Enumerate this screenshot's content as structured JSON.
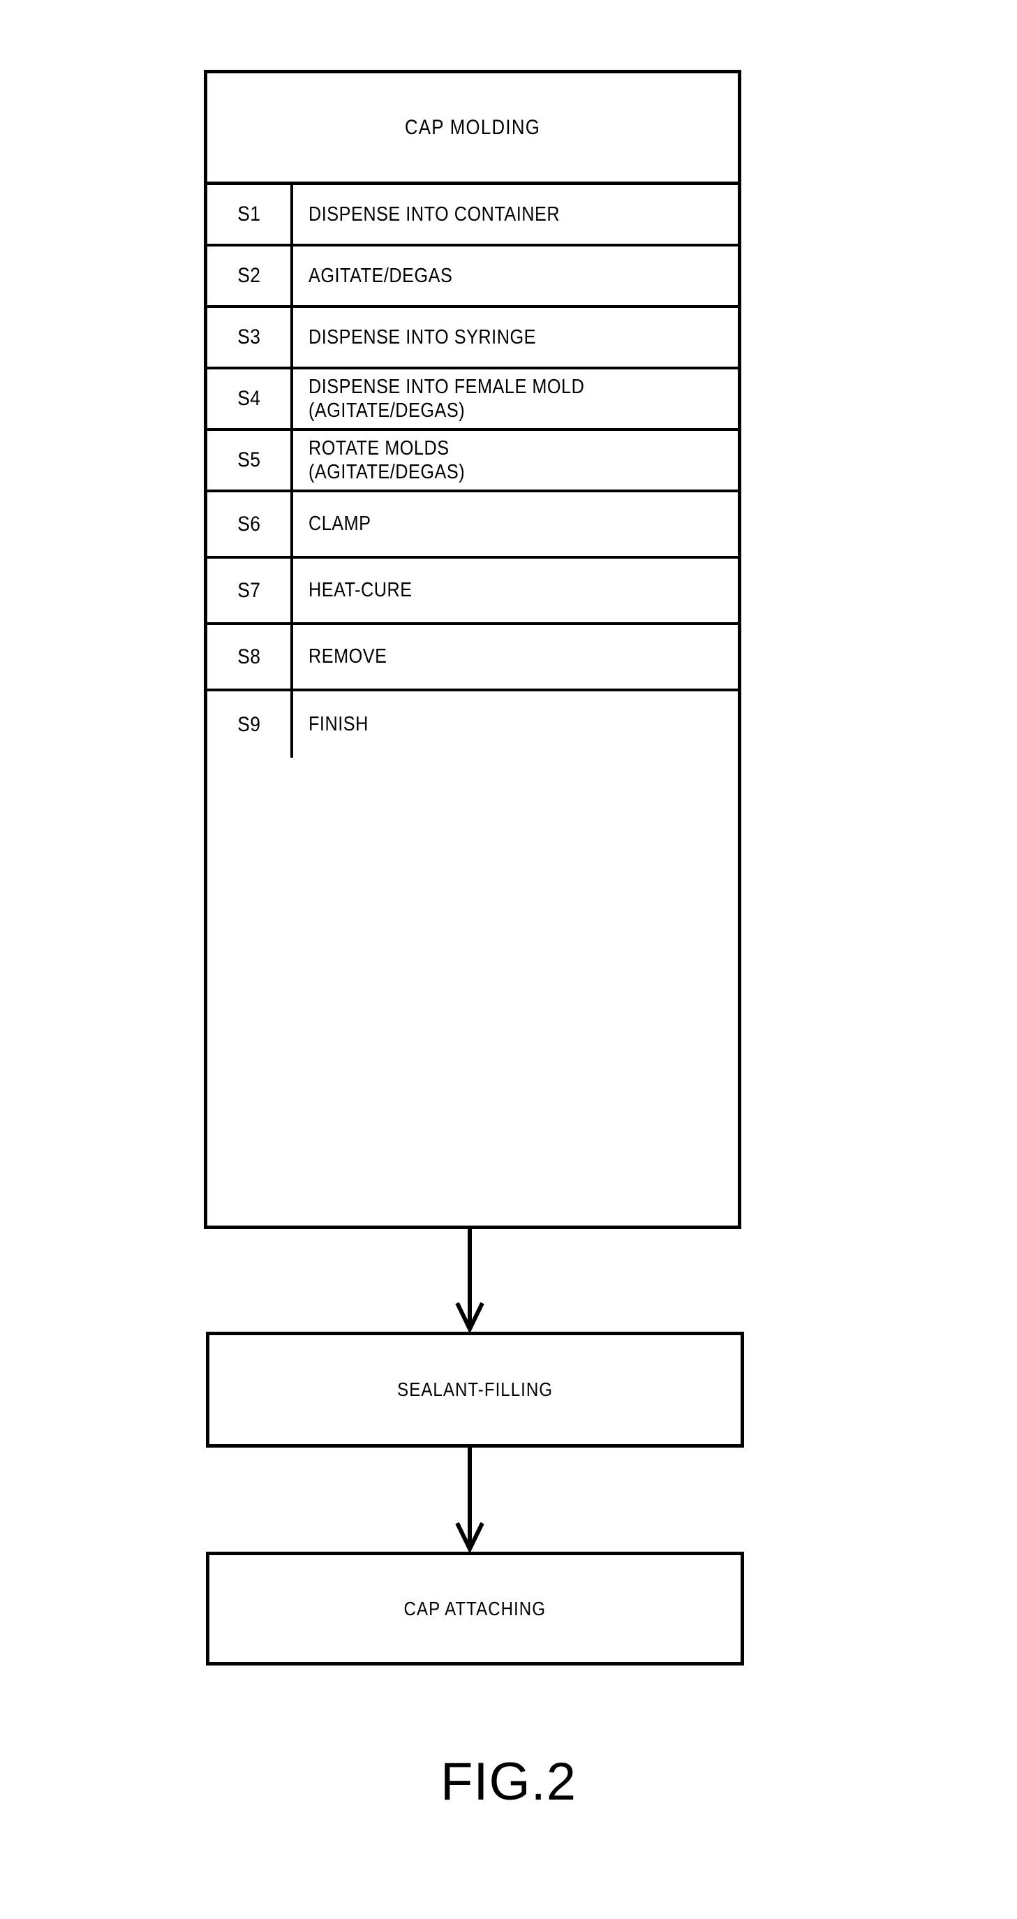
{
  "figure": {
    "caption": "FIG.2",
    "colors": {
      "ink": "#000000",
      "background": "#ffffff"
    }
  },
  "molding_table": {
    "header": "CAP MOLDING",
    "steps": [
      {
        "id": "S1",
        "lines": [
          "DISPENSE INTO CONTAINER"
        ]
      },
      {
        "id": "S2",
        "lines": [
          "AGITATE/DEGAS"
        ]
      },
      {
        "id": "S3",
        "lines": [
          "DISPENSE INTO SYRINGE"
        ]
      },
      {
        "id": "S4",
        "lines": [
          "DISPENSE INTO FEMALE MOLD",
          "(AGITATE/DEGAS)"
        ]
      },
      {
        "id": "S5",
        "lines": [
          "ROTATE MOLDS",
          "(AGITATE/DEGAS)"
        ]
      },
      {
        "id": "S6",
        "lines": [
          "CLAMP"
        ]
      },
      {
        "id": "S7",
        "lines": [
          "HEAT-CURE"
        ]
      },
      {
        "id": "S8",
        "lines": [
          "REMOVE"
        ]
      },
      {
        "id": "S9",
        "lines": [
          "FINISH"
        ]
      }
    ]
  },
  "process_boxes": [
    {
      "label": "SEALANT-FILLING"
    },
    {
      "label": "CAP ATTACHING"
    }
  ],
  "flow": {
    "arrows": [
      {
        "from": "cap-molding-table",
        "to": "sealant-filling-box"
      },
      {
        "from": "sealant-filling-box",
        "to": "cap-attaching-box"
      }
    ]
  }
}
